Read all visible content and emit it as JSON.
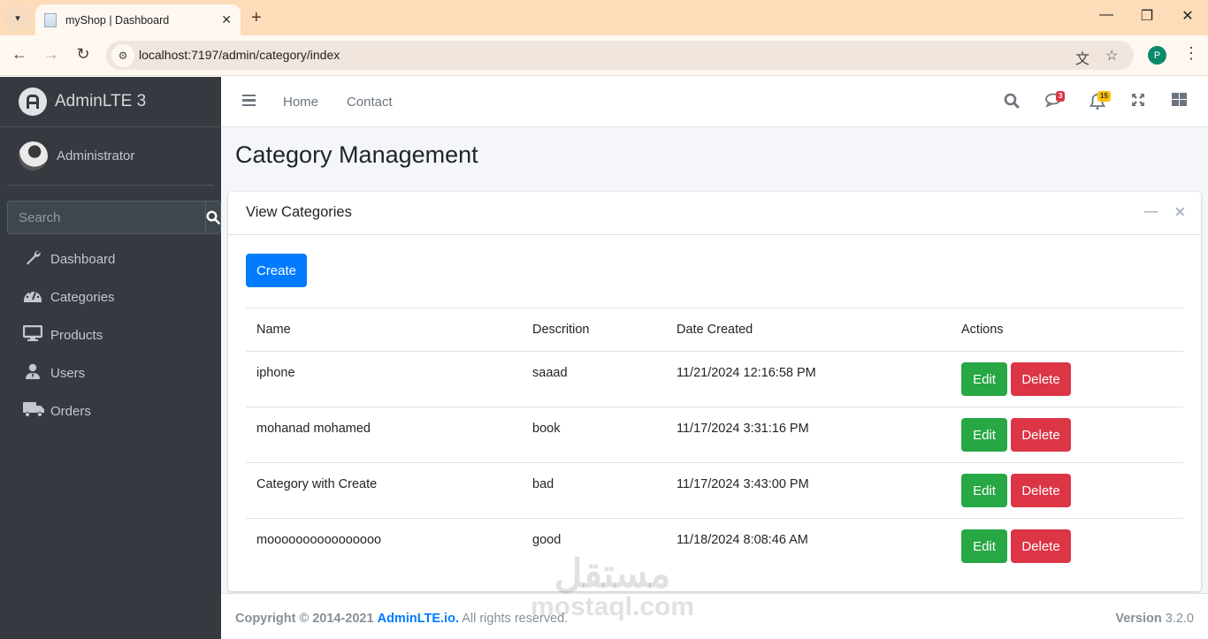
{
  "browser": {
    "tab_title": "myShop | Dashboard",
    "url": "localhost:7197/admin/category/index",
    "profile_initial": "P"
  },
  "sidebar": {
    "brand": "AdminLTE 3",
    "user_name": "Administrator",
    "search_placeholder": "Search",
    "items": [
      {
        "label": "Dashboard",
        "icon": "wrench-icon",
        "glyph": "🔧"
      },
      {
        "label": "Categories",
        "icon": "tachometer-icon",
        "glyph": "◔"
      },
      {
        "label": "Products",
        "icon": "desktop-icon",
        "glyph": "🖥"
      },
      {
        "label": "Users",
        "icon": "user-tie-icon",
        "glyph": "👤"
      },
      {
        "label": "Orders",
        "icon": "truck-icon",
        "glyph": "🚚"
      }
    ]
  },
  "navbar": {
    "links": [
      "Home",
      "Contact"
    ],
    "messages_count": "3",
    "notifications_count": "15",
    "colors": {
      "danger": "#dc3545",
      "warning": "#ffc107"
    }
  },
  "page": {
    "title": "Category Management",
    "card_title": "View Categories",
    "create_label": "Create",
    "table": {
      "headers": [
        "Name",
        "Descrition",
        "Date Created",
        "Actions"
      ],
      "rows": [
        {
          "name": "iphone",
          "description": "saaad",
          "date": "11/21/2024 12:16:58 PM"
        },
        {
          "name": "mohanad mohamed",
          "description": "book",
          "date": "11/17/2024 3:31:16 PM"
        },
        {
          "name": "Category with Create",
          "description": "bad",
          "date": "11/17/2024 3:43:00 PM"
        },
        {
          "name": "moooooooooooooooo",
          "description": "good",
          "date": "11/18/2024 8:08:46 AM"
        }
      ],
      "edit_label": "Edit",
      "delete_label": "Delete"
    }
  },
  "footer": {
    "copyright_prefix": "Copyright © 2014-2021",
    "link_text": "AdminLTE.io.",
    "suffix": "All rights reserved.",
    "version_label": "Version",
    "version": "3.2.0"
  },
  "watermark": {
    "line1": "مستقل",
    "line2": "mostaql.com"
  }
}
